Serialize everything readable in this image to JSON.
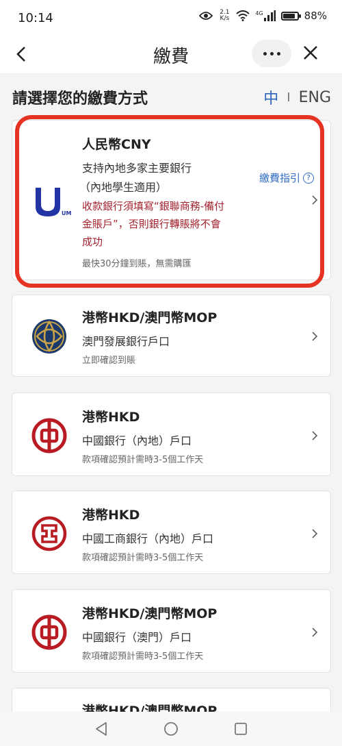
{
  "status": {
    "time": "10:14",
    "net_speed_value": "2.1",
    "net_speed_unit": "K/s",
    "network": "4G",
    "battery": "88%",
    "battery_level": 0.88
  },
  "nav": {
    "title": "繳費"
  },
  "header": {
    "title": "請選擇您的繳費方式",
    "lang_zh": "中",
    "lang_sep": "I",
    "lang_en": "ENG"
  },
  "cards": [
    {
      "icon": "unionpay-u-icon",
      "icon_text": "UM",
      "title": "人民幣CNY",
      "line1": "支持內地多家主要銀行",
      "line2": "（內地學生適用）",
      "warning": "收款銀行須填寫“銀聯商務-備付金賬戶”，否則銀行轉賬將不會成功",
      "note": "最快30分鐘到賬，無需購匯",
      "guide": "繳費指引"
    },
    {
      "icon": "bnu-emblem-icon",
      "title": "港幣HKD/澳門幣MOP",
      "line1": "澳門發展銀行戶口",
      "note": "立即確認到賬"
    },
    {
      "icon": "bank-of-china-icon",
      "title": "港幣HKD",
      "line1": "中國銀行（內地）戶口",
      "note": "款項確認預計需時3-5個工作天"
    },
    {
      "icon": "icbc-icon",
      "title": "港幣HKD",
      "line1": "中國工商銀行（內地）戶口",
      "note": "款項確認預計需時3-5個工作天"
    },
    {
      "icon": "bank-of-china-icon",
      "title": "港幣HKD/澳門幣MOP",
      "line1": "中國銀行（澳門）戶口",
      "note": "款項確認預計需時3-5個工作天"
    },
    {
      "title": "港幣HKD/澳門幣MOP"
    }
  ],
  "colors": {
    "accent_blue": "#2f6bc2",
    "warning_red": "#a3232f",
    "highlight_red": "#e63223",
    "boc_red": "#b81c22",
    "unionpay_blue": "#2233a6"
  }
}
